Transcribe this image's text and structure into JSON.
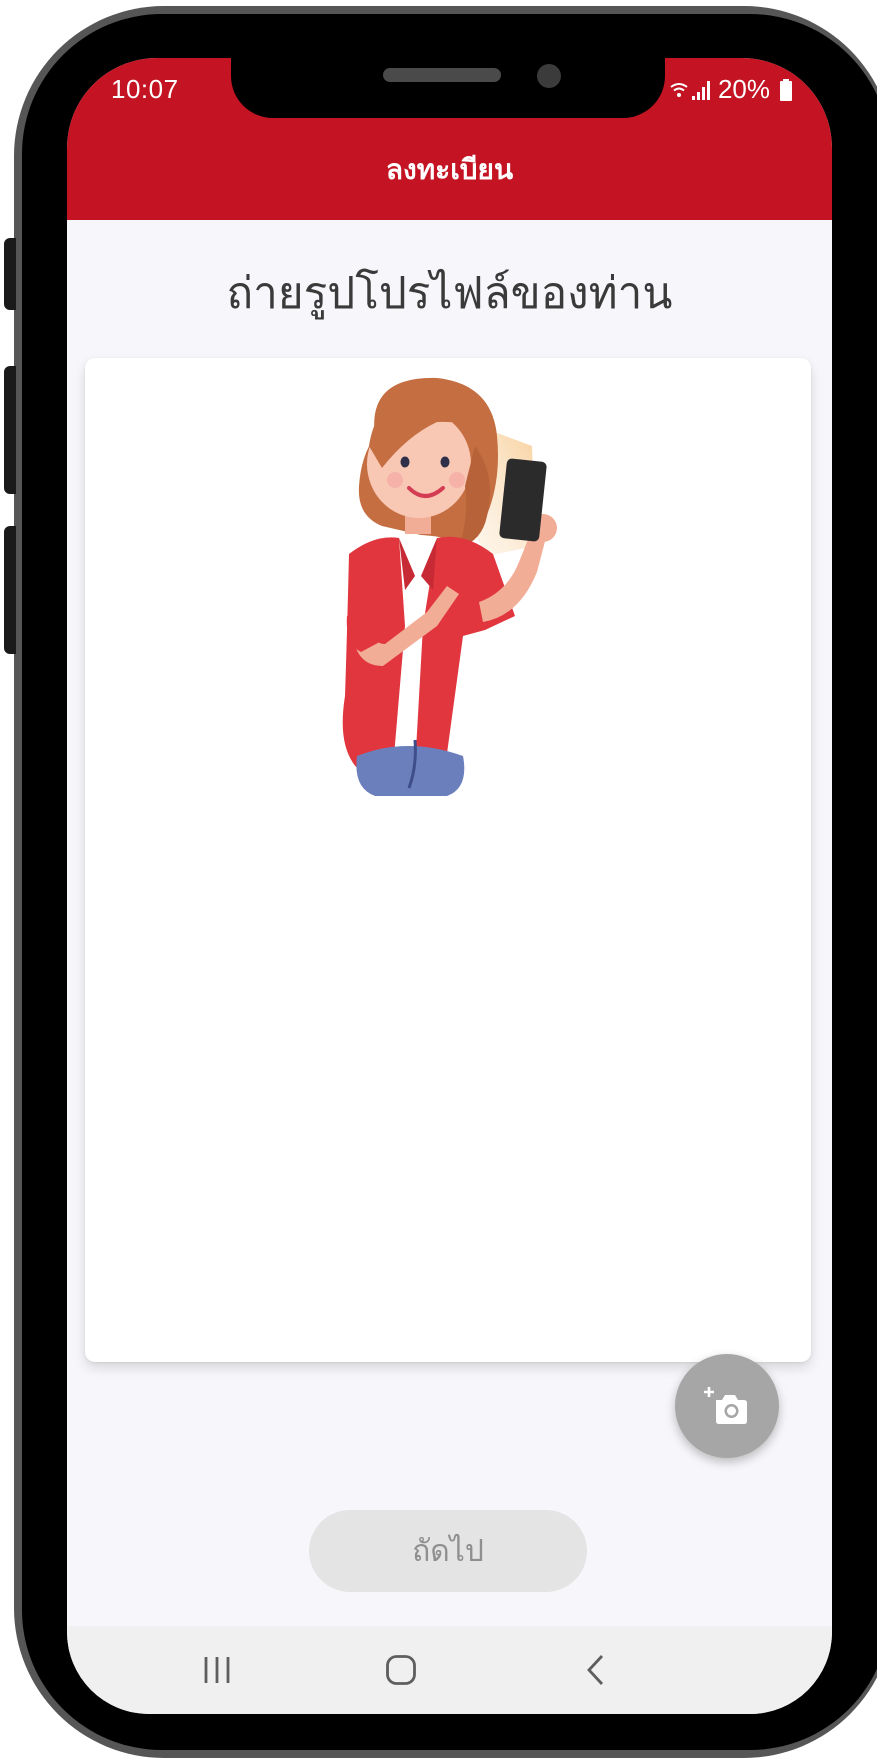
{
  "status_bar": {
    "time": "10:07",
    "battery": "20%",
    "icons": [
      "wifi-icon",
      "signal-icon",
      "battery-icon"
    ]
  },
  "app_bar": {
    "title": "ลงทะเบียน"
  },
  "main": {
    "title": "ถ่ายรูปโปรไฟล์ของท่าน",
    "illustration": "woman-taking-selfie-illustration",
    "fab_icon": "add-camera-icon"
  },
  "footer": {
    "next_label": "ถัดไป"
  },
  "nav_bar": {
    "icons": [
      "recent-apps-icon",
      "home-icon",
      "back-icon"
    ]
  },
  "colors": {
    "brand": "#c41424",
    "fab": "#a6a6a6",
    "button_disabled_bg": "#e4e4e4",
    "button_disabled_text": "#8f8f8f"
  }
}
